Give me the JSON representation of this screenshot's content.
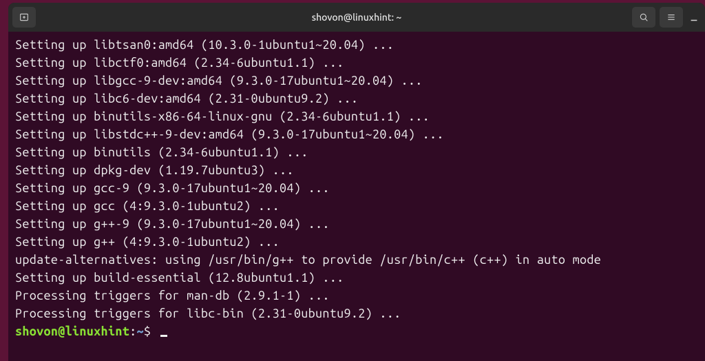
{
  "titlebar": {
    "title": "shovon@linuxhint: ~"
  },
  "terminal": {
    "lines": [
      "Setting up libtsan0:amd64 (10.3.0-1ubuntu1~20.04) ...",
      "Setting up libctf0:amd64 (2.34-6ubuntu1.1) ...",
      "Setting up libgcc-9-dev:amd64 (9.3.0-17ubuntu1~20.04) ...",
      "Setting up libc6-dev:amd64 (2.31-0ubuntu9.2) ...",
      "Setting up binutils-x86-64-linux-gnu (2.34-6ubuntu1.1) ...",
      "Setting up libstdc++-9-dev:amd64 (9.3.0-17ubuntu1~20.04) ...",
      "Setting up binutils (2.34-6ubuntu1.1) ...",
      "Setting up dpkg-dev (1.19.7ubuntu3) ...",
      "Setting up gcc-9 (9.3.0-17ubuntu1~20.04) ...",
      "Setting up gcc (4:9.3.0-1ubuntu2) ...",
      "Setting up g++-9 (9.3.0-17ubuntu1~20.04) ...",
      "Setting up g++ (4:9.3.0-1ubuntu2) ...",
      "update-alternatives: using /usr/bin/g++ to provide /usr/bin/c++ (c++) in auto mode",
      "Setting up build-essential (12.8ubuntu1.1) ...",
      "Processing triggers for man-db (2.9.1-1) ...",
      "Processing triggers for libc-bin (2.31-0ubuntu9.2) ..."
    ],
    "prompt": {
      "user_host": "shovon@linuxhint",
      "colon": ":",
      "path": "~",
      "dollar": "$"
    }
  }
}
